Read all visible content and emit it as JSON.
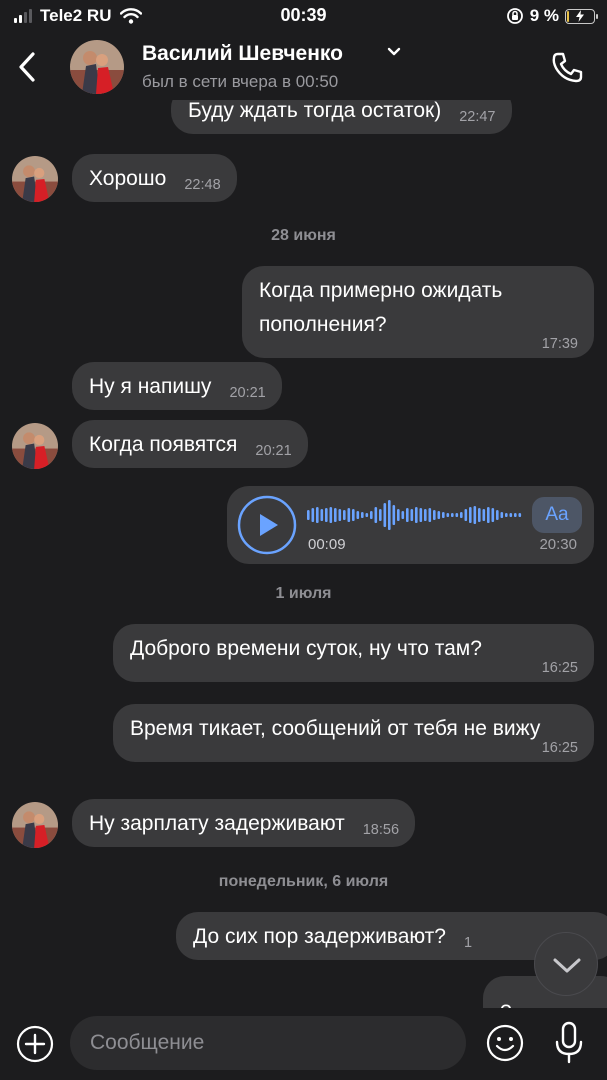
{
  "status_bar": {
    "carrier": "Tele2 RU",
    "time": "00:39",
    "battery": "9 %",
    "battery_level": 0.09
  },
  "header": {
    "contact_name": "Василий Шевченко",
    "status": "был в сети вчера в 00:50"
  },
  "messages": [
    {
      "side": "incoming",
      "text": "Буду ждать тогда остаток)",
      "time": "22:47"
    },
    {
      "side": "incoming",
      "text": "Хорошо",
      "time": "22:48"
    },
    {
      "side": "outgoing",
      "text": "Когда примерно ожидать пополнения?",
      "time": "17:39"
    },
    {
      "side": "incoming",
      "text": "Ну я напишу",
      "time": "20:21"
    },
    {
      "side": "incoming",
      "text": "Когда появятся",
      "time": "20:21"
    },
    {
      "side": "outgoing",
      "type": "voice",
      "duration": "00:09",
      "time": "20:30",
      "transcribe_label": "Aa"
    },
    {
      "side": "outgoing",
      "text": "Доброго времени суток, ну что там?",
      "time": "16:25"
    },
    {
      "side": "outgoing",
      "text": "Время тикает, сообщений от тебя не вижу",
      "time": "16:25"
    },
    {
      "side": "incoming",
      "text": "Ну зарплату задерживают",
      "time": "18:56"
    },
    {
      "side": "outgoing",
      "text": "До сих пор задерживают?",
      "time": "1"
    },
    {
      "side": "outgoing",
      "text": "?",
      "time": ""
    }
  ],
  "dates": [
    "28 июня",
    "1 июля",
    "понедельник, 6 июля"
  ],
  "input": {
    "placeholder": "Сообщение"
  },
  "icons": [
    "back-chevron-icon",
    "chevron-down-icon",
    "phone-icon",
    "play-icon",
    "attach-icon",
    "sticker-icon",
    "mic-icon",
    "scroll-down-icon"
  ],
  "colors": {
    "background": "#1c1c1e",
    "bubble": "#3a3a3c",
    "accent": "#6aa3ff",
    "secondary_text": "#8e8e93"
  }
}
